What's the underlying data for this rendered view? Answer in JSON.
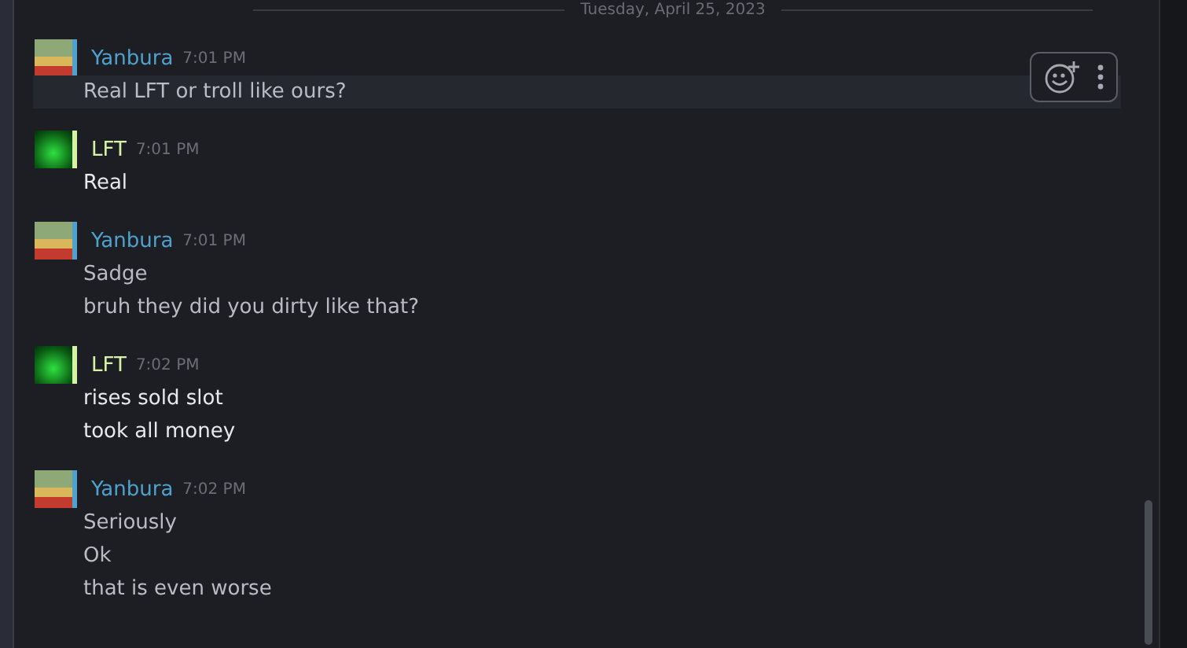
{
  "date_divider": "Tuesday, April 25, 2023",
  "messages": [
    {
      "author": "Yanbura",
      "color": "#4ea2cd",
      "kind": "frog",
      "time": "7:01 PM",
      "lines": [
        {
          "text": "Real LFT or troll like ours?",
          "hovered": true
        }
      ]
    },
    {
      "author": "LFT",
      "color": "#d6f2a4",
      "kind": "green",
      "time": "7:01 PM",
      "lines": [
        {
          "text": "Real",
          "hovered": false
        }
      ]
    },
    {
      "author": "Yanbura",
      "color": "#4ea2cd",
      "kind": "frog",
      "time": "7:01 PM",
      "lines": [
        {
          "text": "Sadge",
          "hovered": false
        },
        {
          "text": "bruh they did you dirty like that?",
          "hovered": false
        }
      ]
    },
    {
      "author": "LFT",
      "color": "#d6f2a4",
      "kind": "green",
      "time": "7:02 PM",
      "lines": [
        {
          "text": "rises sold slot",
          "hovered": false
        },
        {
          "text": "took all money",
          "hovered": false
        }
      ]
    },
    {
      "author": "Yanbura",
      "color": "#4ea2cd",
      "kind": "frog",
      "time": "7:02 PM",
      "lines": [
        {
          "text": "Seriously",
          "hovered": false
        },
        {
          "text": "Ok",
          "hovered": false
        },
        {
          "text": "that is even worse",
          "hovered": false
        }
      ]
    }
  ]
}
